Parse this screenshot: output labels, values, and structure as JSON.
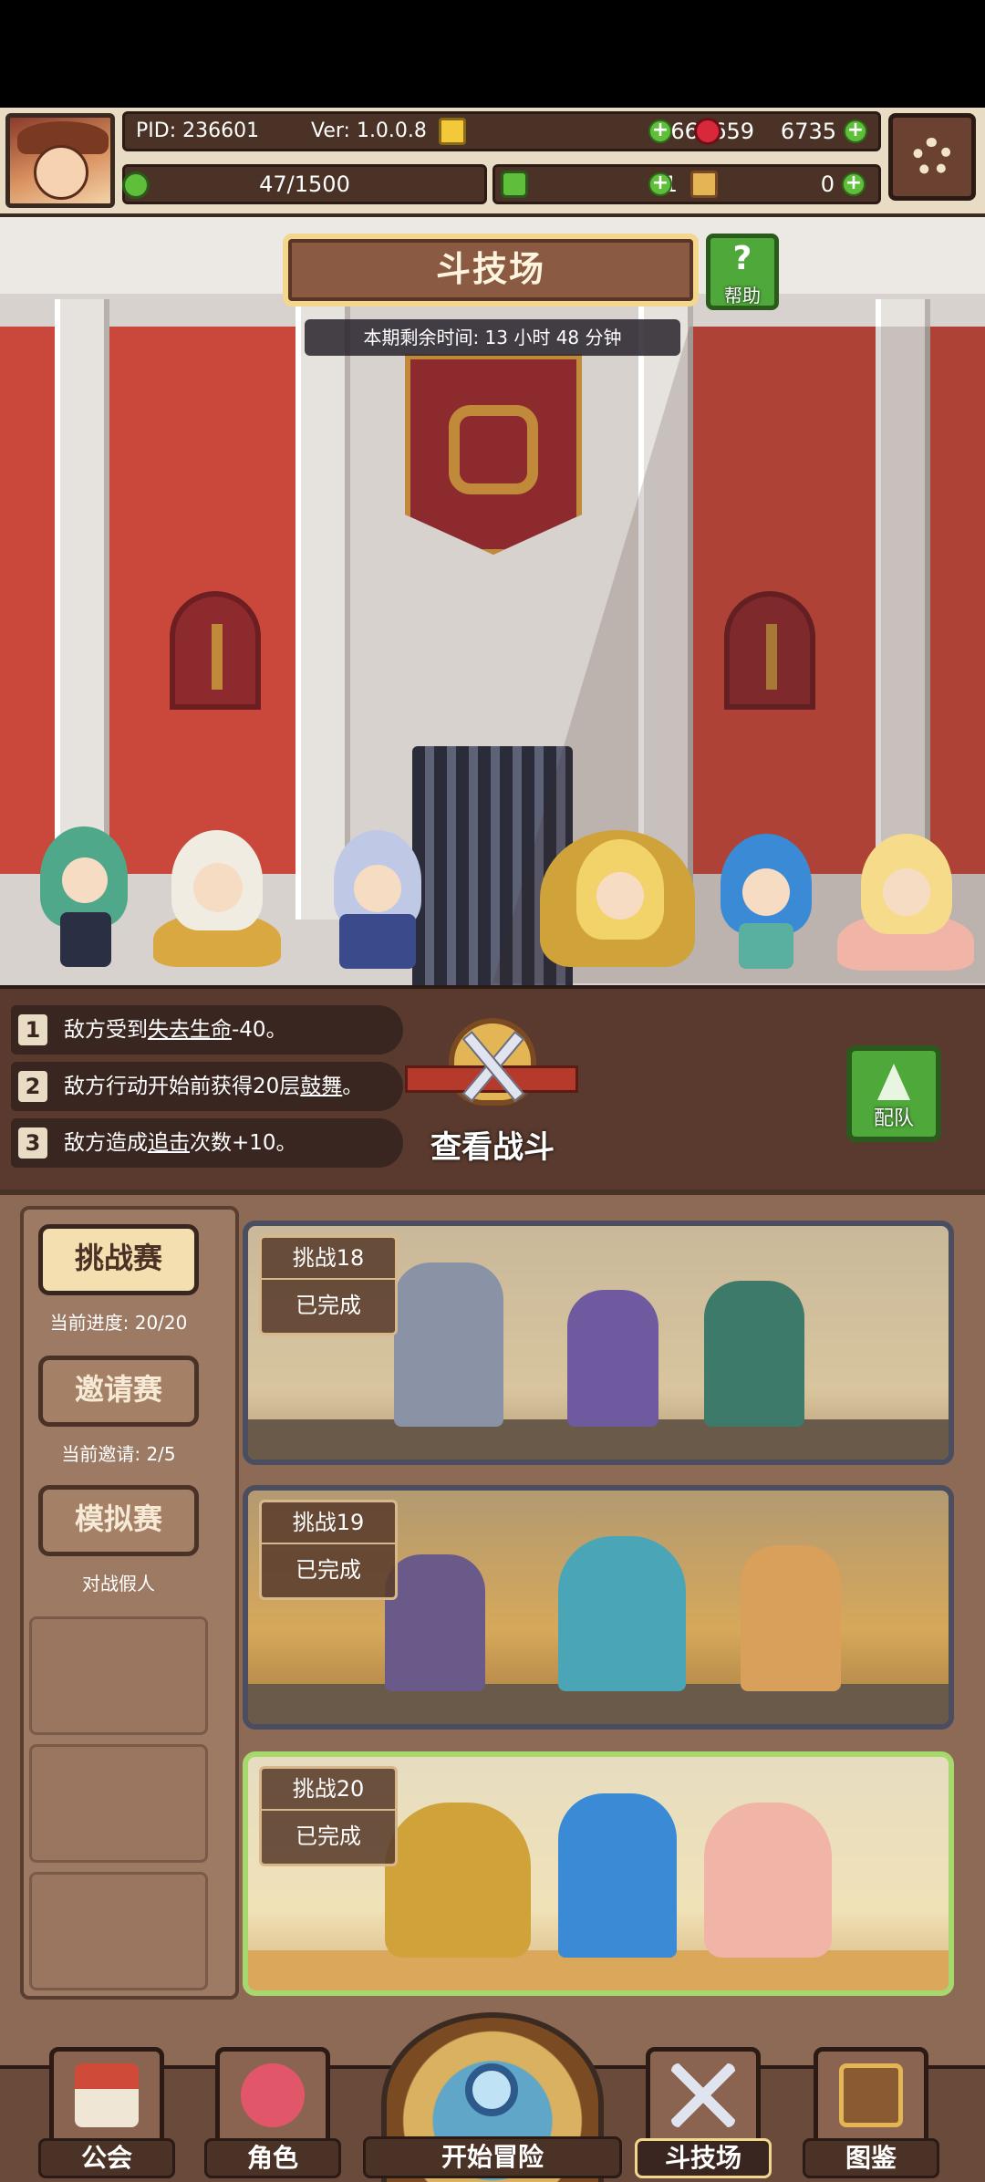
{
  "header": {
    "pid": "PID: 236601",
    "version": "Ver: 1.0.0.8",
    "gold": "2664659",
    "ruby": "6735",
    "energy": "47/1500",
    "clover": "11",
    "key": "0"
  },
  "arena": {
    "title": "斗技场",
    "help_label": "帮助",
    "timer": "本期剩余时间: 13 小时 48 分钟"
  },
  "buffs": [
    {
      "num": "1",
      "pre": "敌方受到",
      "link": "失去生命",
      "post": "-40。"
    },
    {
      "num": "2",
      "pre": "敌方行动开始前获得20层",
      "link": "鼓舞",
      "post": "。"
    },
    {
      "num": "3",
      "pre": "敌方造成",
      "link": "追击",
      "post": "次数+10。"
    }
  ],
  "view_battle": "查看战斗",
  "team_label": "配队",
  "tabs": [
    {
      "label": "挑战赛",
      "sub": "当前进度: 20/20"
    },
    {
      "label": "邀请赛",
      "sub": "当前邀请: 2/5"
    },
    {
      "label": "模拟赛",
      "sub": "对战假人"
    }
  ],
  "challenges": [
    {
      "name": "挑战18",
      "status": "已完成"
    },
    {
      "name": "挑战19",
      "status": "已完成"
    },
    {
      "name": "挑战20",
      "status": "已完成"
    }
  ],
  "nav": {
    "guild": "公会",
    "role": "角色",
    "adventure": "开始冒险",
    "arena": "斗技场",
    "codex": "图鉴"
  },
  "colors": {
    "accent_green": "#5fbf3a",
    "brown_panel": "#5a3a2e",
    "arena_red": "#c9483b"
  }
}
